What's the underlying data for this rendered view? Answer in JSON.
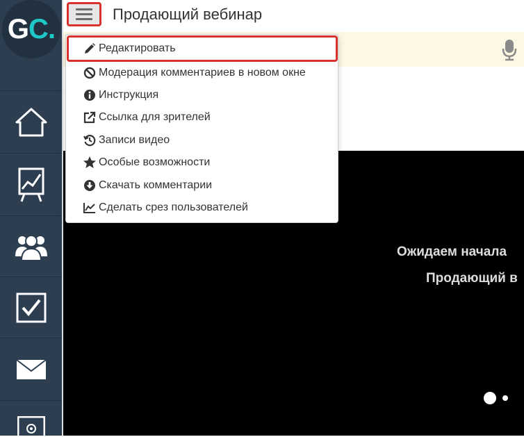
{
  "app": {
    "logo_text_g": "G",
    "logo_text_c": "C",
    "logo_text_dot": ".",
    "brand_color": "#1ec8c8",
    "sidebar_color": "#2c3e50"
  },
  "header": {
    "title": "Продающий вебинар",
    "menu_icon": "hamburger-icon"
  },
  "sidebar": {
    "items": [
      {
        "icon": "home-icon"
      },
      {
        "icon": "chart-board-icon"
      },
      {
        "icon": "users-icon"
      },
      {
        "icon": "checkbox-icon"
      },
      {
        "icon": "mail-icon"
      },
      {
        "icon": "settings-icon"
      }
    ]
  },
  "dropdown": {
    "items": [
      {
        "label": "Редактировать",
        "icon": "pencil-icon"
      },
      {
        "label": "Модерация комментариев в новом окне",
        "icon": "ban-icon"
      },
      {
        "label": "Инструкция",
        "icon": "info-icon"
      },
      {
        "label": "Ссылка для зрителей",
        "icon": "external-link-icon"
      },
      {
        "label": "Записи видео",
        "icon": "history-icon"
      },
      {
        "label": "Особые возможности",
        "icon": "star-icon"
      },
      {
        "label": "Скачать комментарии",
        "icon": "download-icon"
      },
      {
        "label": "Сделать срез пользователей",
        "icon": "line-chart-icon"
      }
    ]
  },
  "video": {
    "waiting_text": "Ожидаем начала",
    "title": "Продающий в"
  },
  "colors": {
    "highlight": "#d9322c",
    "notice_bg": "#fcf8e3"
  }
}
